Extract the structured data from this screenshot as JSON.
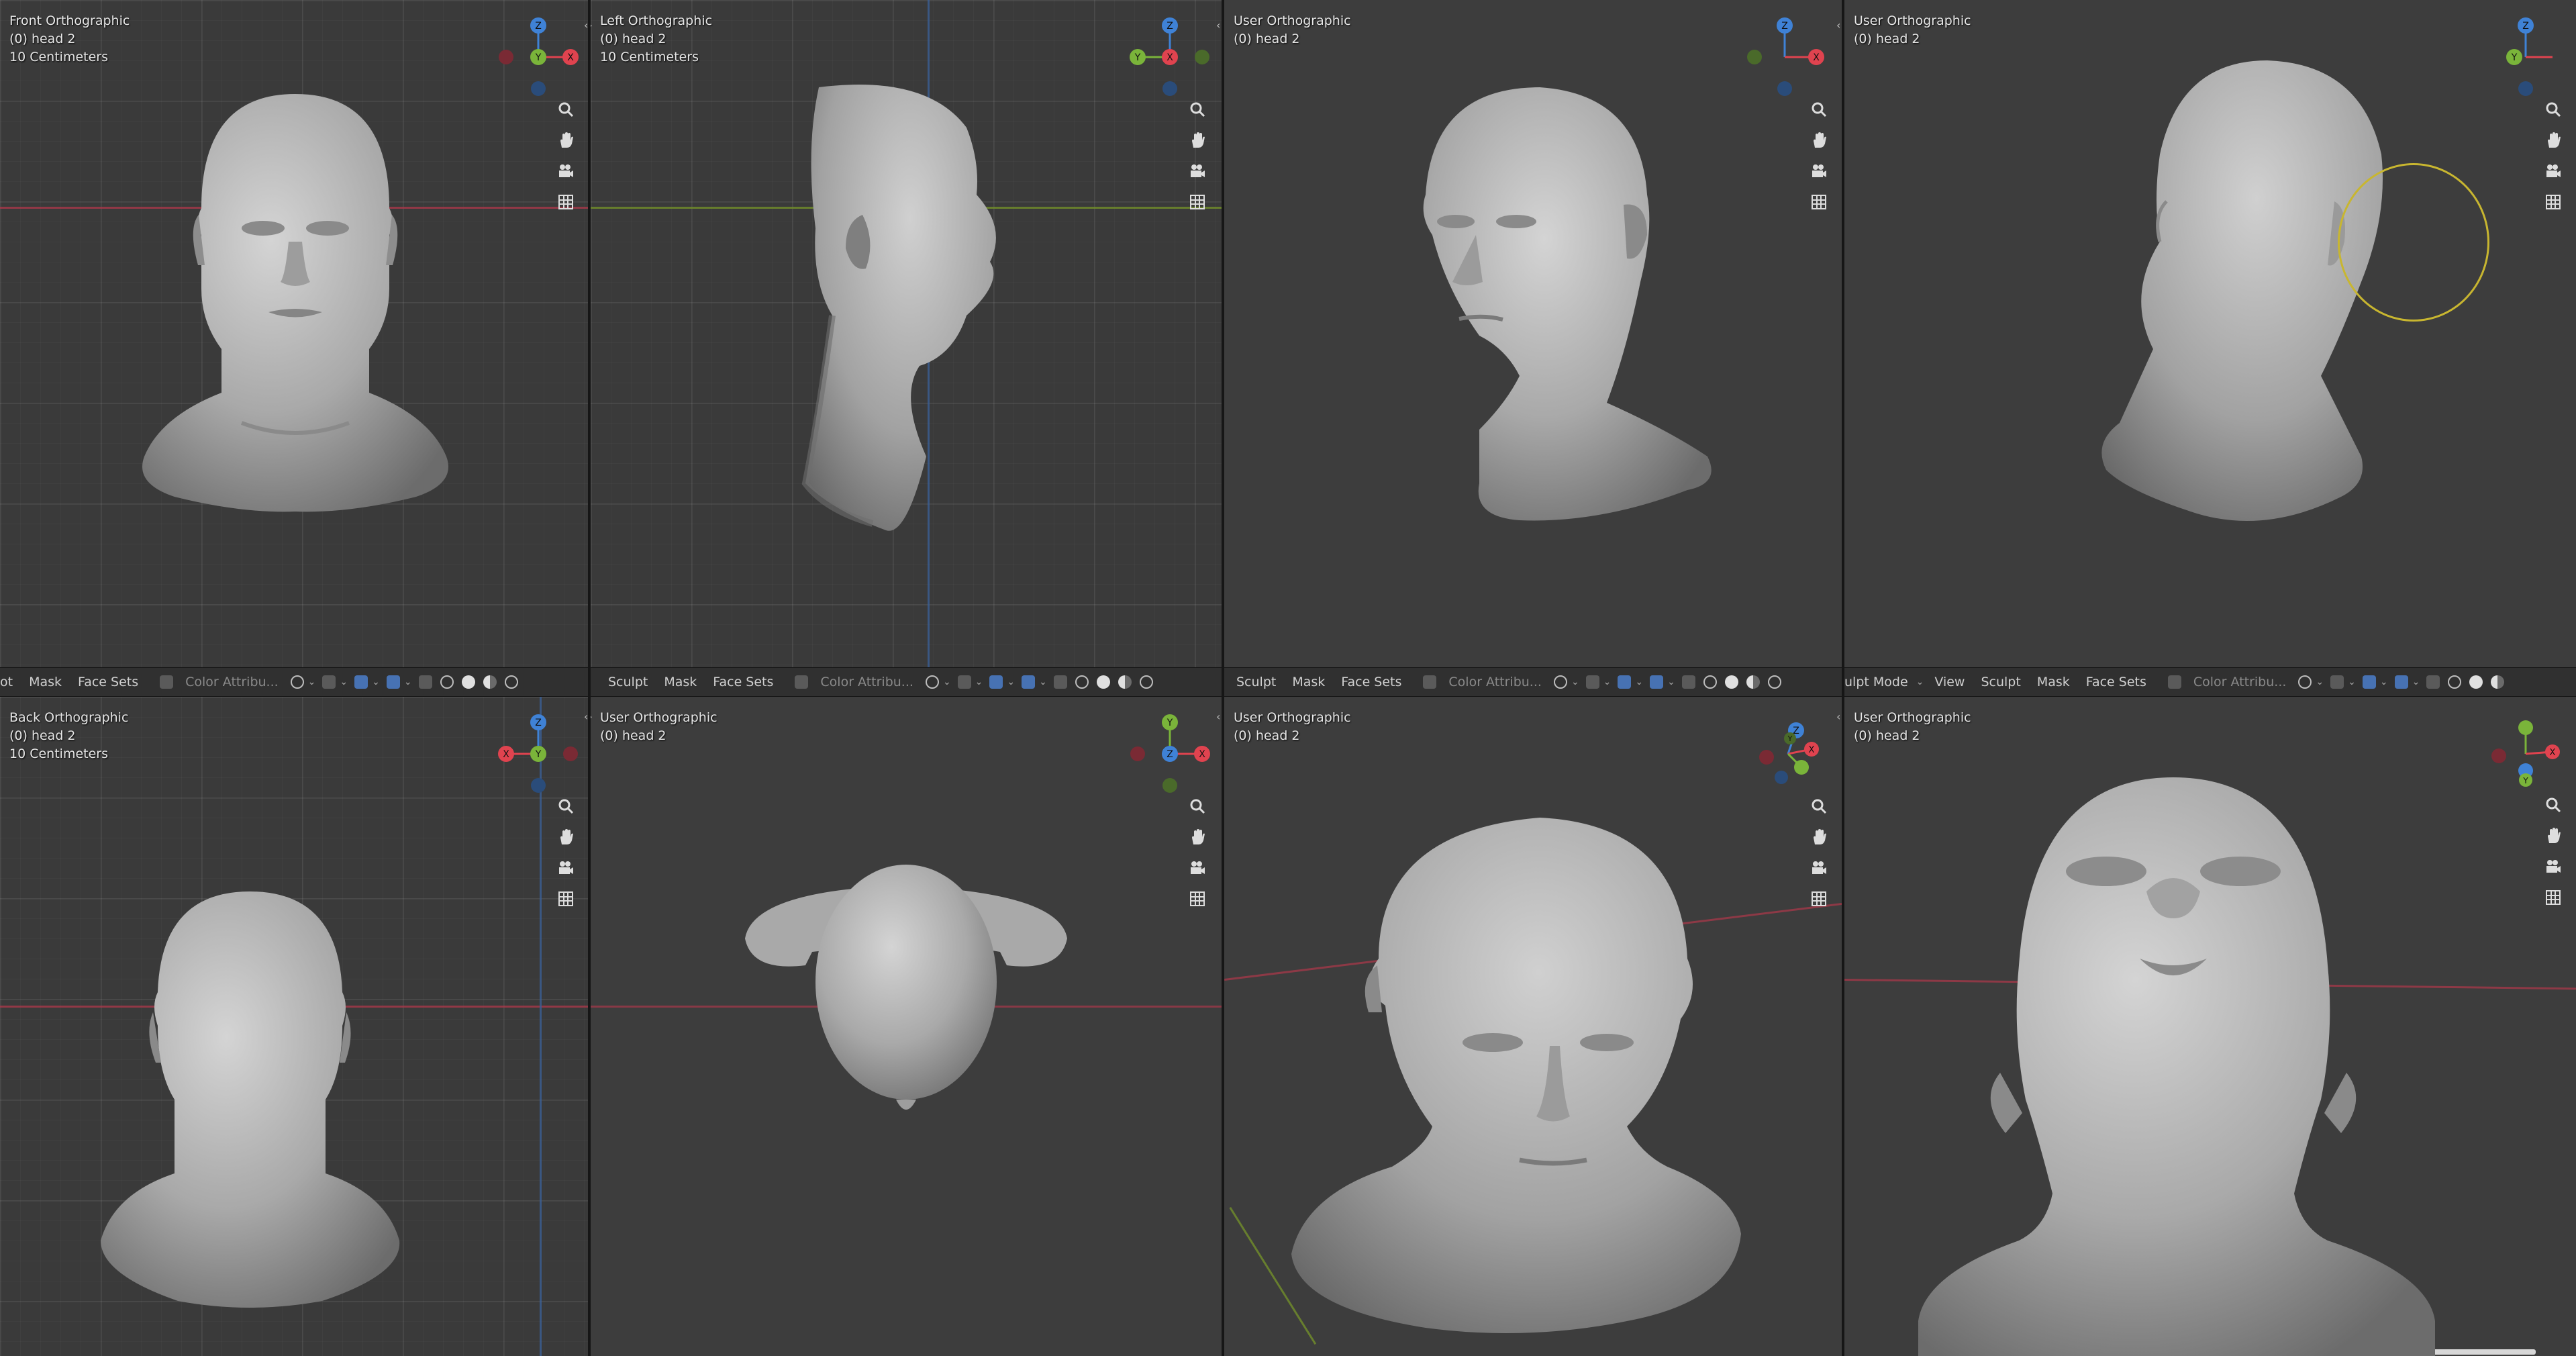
{
  "app": "Blender",
  "viewports": [
    {
      "name": "Front Orthographic",
      "object": "(0) head 2",
      "scale": "10 Centimeters"
    },
    {
      "name": "Left Orthographic",
      "object": "(0) head 2",
      "scale": "10 Centimeters"
    },
    {
      "name": "User Orthographic",
      "object": "(0) head 2"
    },
    {
      "name": "User Orthographic",
      "object": "(0) head 2"
    },
    {
      "name": "Back Orthographic",
      "object": "(0) head 2",
      "scale": "10 Centimeters"
    },
    {
      "name": "User Orthographic",
      "object": "(0) head 2"
    },
    {
      "name": "User Orthographic",
      "object": "(0) head 2"
    },
    {
      "name": "User Orthographic",
      "object": "(0) head 2"
    }
  ],
  "headers": [
    {
      "items": [
        "ot",
        "Mask",
        "Face Sets"
      ],
      "color_attr": "Color Attribu..."
    },
    {
      "items": [
        "Sculpt",
        "Mask",
        "Face Sets"
      ],
      "color_attr": "Color Attribu..."
    },
    {
      "items": [
        "Sculpt",
        "Mask",
        "Face Sets"
      ],
      "color_attr": "Color Attribu..."
    },
    {
      "items": [
        "ulpt Mode",
        "View",
        "Sculpt",
        "Mask",
        "Face Sets"
      ],
      "color_attr": "Color Attribu..."
    }
  ],
  "gizmo_labels": {
    "x": "X",
    "y": "Y",
    "z": "Z"
  },
  "colors": {
    "x_axis": "#e0434f",
    "y_axis": "#7ab43a",
    "z_axis": "#3f82d6",
    "brush": "#c8b630",
    "viewport_bg": "#3d3d3d",
    "grid_bg": "#3a3a3a",
    "header_bg": "#303030"
  },
  "icons": [
    "zoom-icon",
    "pan-hand-icon",
    "camera-icon",
    "grid-toggle-icon"
  ]
}
